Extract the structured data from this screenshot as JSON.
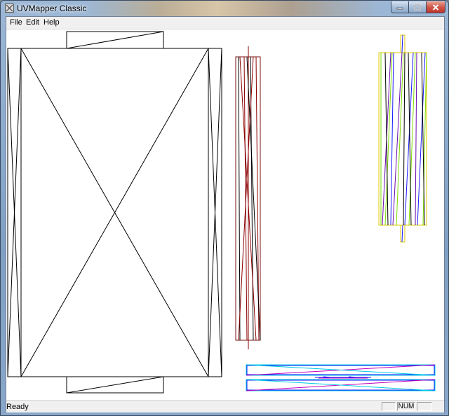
{
  "window": {
    "title": "UVMapper Classic",
    "controls": {
      "minimize_icon": "minimize-icon",
      "maximize_icon": "maximize-icon",
      "close_icon": "close-icon"
    }
  },
  "menu": {
    "items": [
      {
        "label": "File"
      },
      {
        "label": "Edit"
      },
      {
        "label": "Help"
      }
    ]
  },
  "canvas": {
    "description_colors": {
      "black": "#000000",
      "dark_red": "#8b0000",
      "purple": "#6a0dad",
      "green": "#7fdc00",
      "yellow": "#e0c800",
      "cyan": "#00c8e6",
      "magenta": "#c000c0",
      "blue": "#1a1aff"
    }
  },
  "status": {
    "text": "Ready",
    "num_indicator": "NUM"
  }
}
